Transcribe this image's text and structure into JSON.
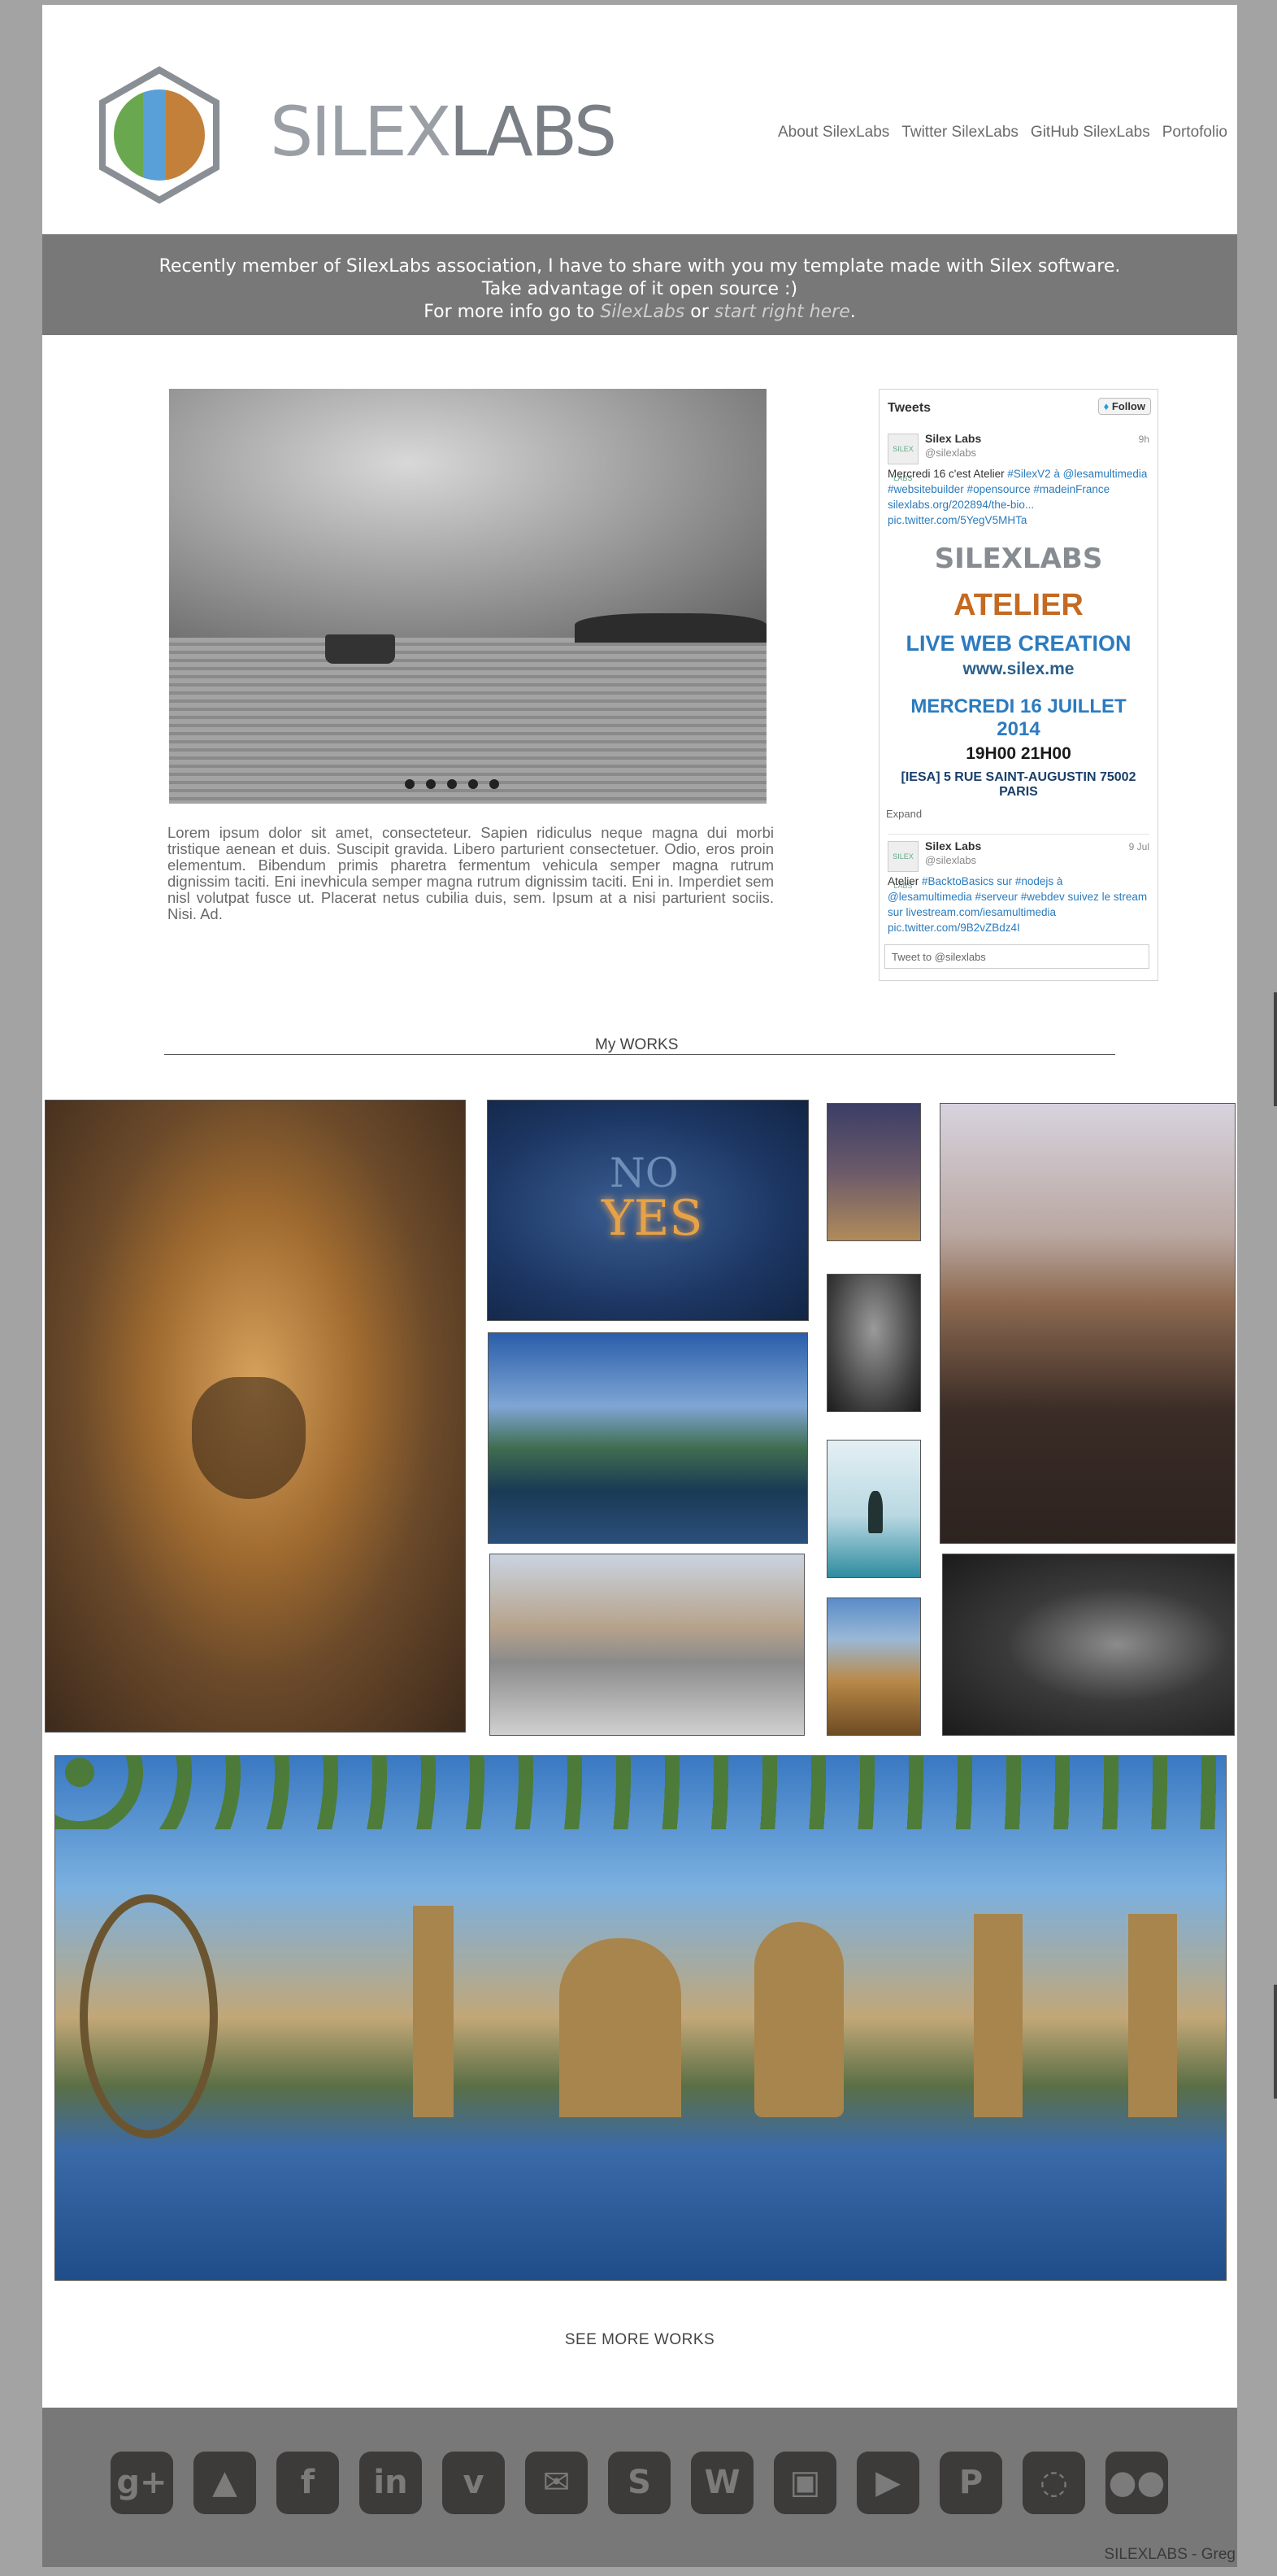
{
  "header": {
    "logo_text_a": "SILEX",
    "logo_text_b": "LABS",
    "nav": [
      "About SilexLabs",
      "Twitter SilexLabs",
      "GitHub SilexLabs",
      "Portofolio"
    ]
  },
  "banner": {
    "line1": "Recently member of SilexLabs association, I have to share with you my template made with Silex software.",
    "line2": "Take advantage of it open source :)",
    "line3_prefix": "For more info go to ",
    "link1": "SilexLabs",
    "middle": " or ",
    "link2": "start right here",
    "suffix": "."
  },
  "slider": {
    "dots": 5
  },
  "intro": "Lorem ipsum dolor sit amet, consecteteur. Sapien ridiculus neque magna dui morbi tristique aenean et duis. Suscipit gravida. Libero parturient consectetuer. Odio, eros proin elementum. Bibendum primis pharetra fermentum vehicula semper magna rutrum dignissim taciti. Eni inevhicula semper magna rutrum dignissim taciti. Eni in. Imperdiet sem nisl volutpat fusce ut. Placerat netus cubilia duis, sem. Ipsum at a nisi parturient sociis. Nisi. Ad.",
  "tweets": {
    "title": "Tweets",
    "follow": "Follow",
    "tweet1": {
      "avatar": "SILEX LABS",
      "name": "Silex Labs",
      "handle": "@silexlabs",
      "time": "9h",
      "text_plain": "Mercredi 16 c'est Atelier ",
      "text_links": "#SilexV2 à @lesamultimedia #websitebuilder #opensource #madeinFrance silexlabs.org/202894/the-bio... pic.twitter.com/5YegV5MHTa"
    },
    "poster": {
      "logo": "SILEXLABS",
      "atelier": "ATELIER",
      "live": "LIVE WEB CREATION",
      "site": "www.silex.me",
      "date": "MERCREDI 16 JUILLET 2014",
      "hours": "19H00  21H00",
      "address": "[IESA] 5 RUE SAINT-AUGUSTIN 75002 PARIS"
    },
    "expand": "Expand",
    "tweet2": {
      "avatar": "SILEX LABS",
      "name": "Silex Labs",
      "handle": "@silexlabs",
      "time": "9 Jul",
      "text_plain": "Atelier ",
      "text_links": "#BacktoBasics sur #nodejs à @lesamultimedia #serveur #webdev suivez le stream sur livestream.com/iesamultimedia pic.twitter.com/9B2vZBdz4I"
    },
    "input_placeholder": "Tweet to @silexlabs"
  },
  "works": {
    "title": "My WORKS",
    "neon_top": "NO",
    "neon_bottom": "YES",
    "see_more": "SEE MORE WORKS"
  },
  "footer": {
    "icons": [
      "g+",
      "▲",
      "f",
      "in",
      "v",
      "✉",
      "S",
      "W",
      "▣",
      "▶",
      "P",
      "◌",
      "●●"
    ],
    "icon_names": [
      "google-plus-icon",
      "behance-icon",
      "facebook-icon",
      "linkedin-icon",
      "vimeo-icon",
      "twitter-icon",
      "skype-icon",
      "wordpress-icon",
      "instagram-icon",
      "youtube-icon",
      "pinterest-icon",
      "dribbble-icon",
      "flickr-icon"
    ],
    "credit": "SILEXLABS - Greg"
  },
  "colors": {
    "banner": "#787878",
    "page": "#ffffff",
    "outer": "#a3a3a3",
    "link": "#2a7bbd"
  }
}
